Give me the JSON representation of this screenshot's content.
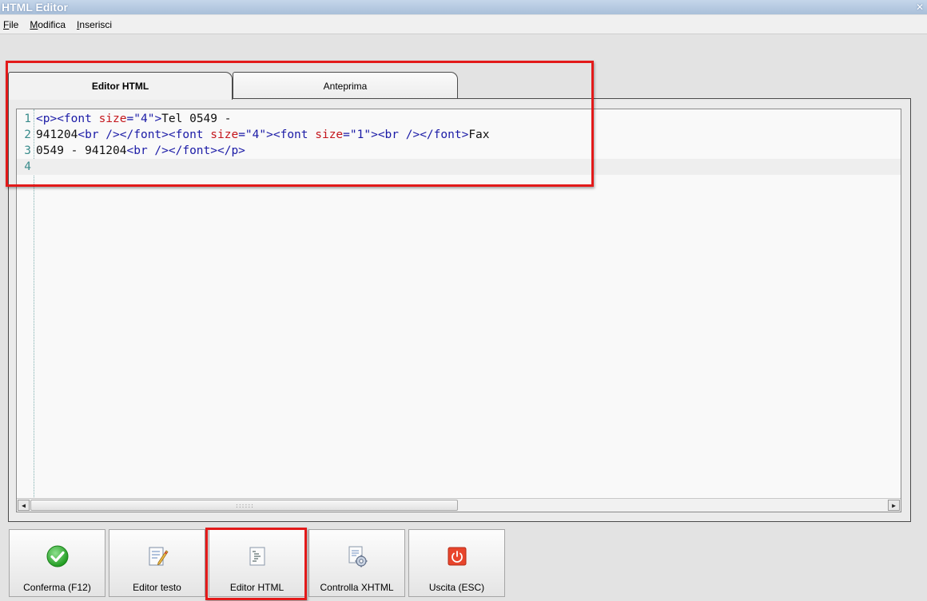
{
  "window": {
    "title": "HTML Editor",
    "close_glyph": "✕"
  },
  "menu": [
    "File",
    "Modifica",
    "Inserisci"
  ],
  "tabs": [
    {
      "label": "Editor HTML",
      "active": true
    },
    {
      "label": "Anteprima",
      "active": false
    }
  ],
  "editor": {
    "line_numbers": [
      "1",
      "2",
      "3",
      "4"
    ],
    "lines": [
      [
        {
          "t": "<p><font ",
          "k": "tag"
        },
        {
          "t": "size",
          "k": "attr"
        },
        {
          "t": "=",
          "k": "tag"
        },
        {
          "t": "\"4\"",
          "k": "val"
        },
        {
          "t": ">",
          "k": "tag"
        },
        {
          "t": "Tel 0549 -",
          "k": "text"
        }
      ],
      [
        {
          "t": "941204",
          "k": "text"
        },
        {
          "t": "<br /></font><font ",
          "k": "tag"
        },
        {
          "t": "size",
          "k": "attr"
        },
        {
          "t": "=",
          "k": "tag"
        },
        {
          "t": "\"4\"",
          "k": "val"
        },
        {
          "t": "><font ",
          "k": "tag"
        },
        {
          "t": "size",
          "k": "attr"
        },
        {
          "t": "=",
          "k": "tag"
        },
        {
          "t": "\"1\"",
          "k": "val"
        },
        {
          "t": "><br /></font>",
          "k": "tag"
        },
        {
          "t": "Fax",
          "k": "text"
        }
      ],
      [
        {
          "t": "0549 - 941204",
          "k": "text"
        },
        {
          "t": "<br /></font></p>",
          "k": "tag"
        }
      ],
      []
    ],
    "current_line": 4,
    "scroll_grip": "::::::"
  },
  "toolbar": [
    {
      "label": "Conferma (F12)",
      "icon": "confirm-check-icon"
    },
    {
      "label": "Editor testo",
      "icon": "text-editor-icon"
    },
    {
      "label": "Editor HTML",
      "icon": "html-editor-icon"
    },
    {
      "label": "Controlla XHTML",
      "icon": "check-xhtml-icon"
    },
    {
      "label": "Uscita (ESC)",
      "icon": "exit-power-icon"
    }
  ],
  "colors": {
    "highlight": "#e31a1a",
    "tag": "#1a1aa6",
    "attr": "#c4161c",
    "confirm_green": "#2fb32f",
    "exit_red": "#e8452c"
  }
}
